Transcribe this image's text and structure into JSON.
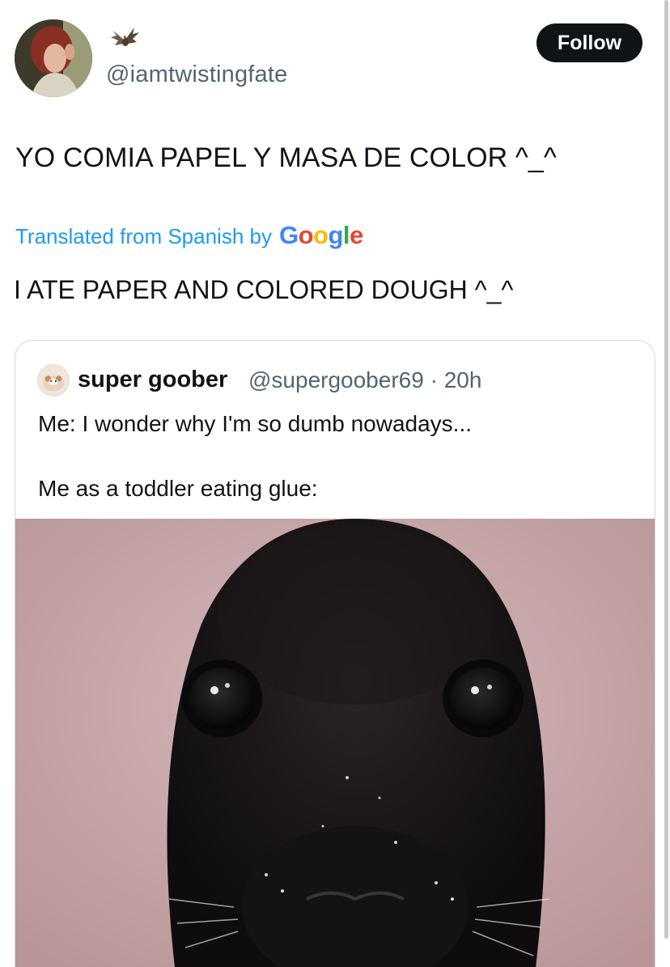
{
  "header": {
    "handle": "@iamtwistingfate",
    "follow_label": "Follow",
    "badge_icon": "bat-icon"
  },
  "tweet": {
    "text": "YO COMIA PAPEL Y MASA DE COLOR ^_^",
    "translated_label": "Translated from Spanish by",
    "translator_brand": "Google",
    "translation": "I ATE PAPER AND COLORED DOUGH ^_^"
  },
  "quote": {
    "name": "super goober",
    "handle": "@supergoober69",
    "separator": "·",
    "time": "20h",
    "line1": "Me: I wonder why I'm so dumb nowadays...",
    "line2": "Me as a toddler eating glue:"
  },
  "colors": {
    "link": "#1d9bf0",
    "button_bg": "#0f1419",
    "secondary_text": "#536471",
    "photo_bg": "#c9a9ab"
  }
}
